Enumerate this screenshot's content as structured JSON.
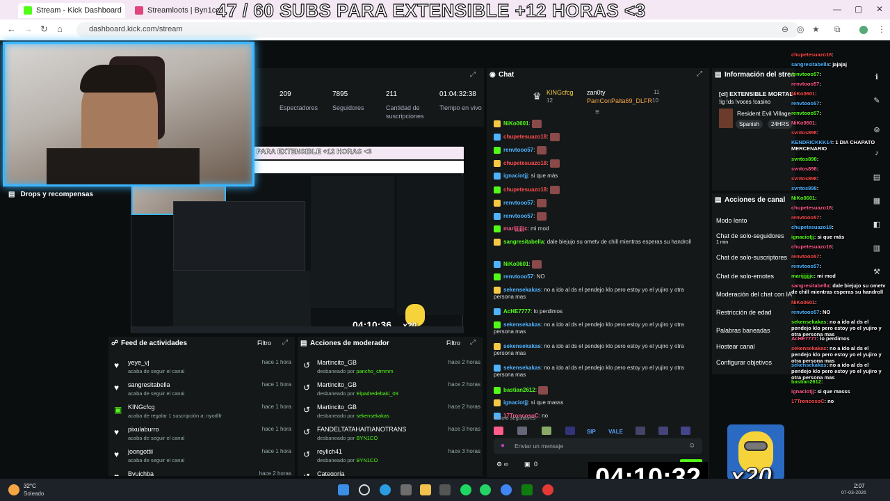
{
  "browser": {
    "tabs": [
      {
        "title": "Stream - Kick Dashboard",
        "active": true
      },
      {
        "title": "Streamloots | Byn1co | Apóyam",
        "active": false
      }
    ],
    "url": "dashboard.kick.com/stream"
  },
  "overlay": {
    "title": "47 / 60 SUBS PARA EXTENSIBLE +12 HORAS <3",
    "timer": "04:10:32",
    "multiplier": "x20",
    "mini_timer": "04:10:36",
    "mini_multiplier": "x20",
    "mini_title": "PARA EXTENSIBLE +12 HORAS <3"
  },
  "stats": [
    {
      "value": "209",
      "label": "Espectadores"
    },
    {
      "value": "7895",
      "label": "Seguidores"
    },
    {
      "value": "211",
      "label": "Cantidad de suscripciones"
    },
    {
      "value": "01:04:32:38",
      "label": "Tiempo en vivo"
    }
  ],
  "left_nav": {
    "drops_label": "Drops y recompensas"
  },
  "activity_feed": {
    "title": "Feed de actividades",
    "filter": "Filtro",
    "items": [
      {
        "name": "yeye_vj",
        "action": "acaba de seguir el canal",
        "time": "hace 1 hora",
        "icon": "heart-icon"
      },
      {
        "name": "sangresitabella",
        "action": "acaba de seguir el canal",
        "time": "hace 1 hora",
        "icon": "heart-icon"
      },
      {
        "name": "KINGcfcg",
        "action": "acaba de regalar 1 suscripción a: nyodlfr",
        "time": "hace 1 hora",
        "icon": "gift-icon"
      },
      {
        "name": "pixulaburro",
        "action": "acaba de seguir el canal",
        "time": "hace 1 hora",
        "icon": "heart-icon"
      },
      {
        "name": "joongottii",
        "action": "acaba de seguir el canal",
        "time": "hace 1 hora",
        "icon": "heart-icon"
      },
      {
        "name": "Byuichba",
        "action": "",
        "time": "hace 2 horas",
        "icon": "heart-icon"
      }
    ]
  },
  "mod_actions": {
    "title": "Acciones de moderador",
    "filter": "Filtro",
    "items": [
      {
        "name": "Martincito_GB",
        "action": "desbaneado por",
        "by": "pancho_ctmmm",
        "time": "hace 2 horas"
      },
      {
        "name": "Martincito_GB",
        "action": "desbaneado por",
        "by": "Elpadredebaki_09",
        "time": "hace 2 horas"
      },
      {
        "name": "Martincito_GB",
        "action": "desbaneado por",
        "by": "sekensekakas",
        "time": "hace 2 horas"
      },
      {
        "name": "FANDELTATAHAITIANOTRANS",
        "action": "desbaneado por",
        "by": "BYN1CO",
        "time": "hace 3 horas"
      },
      {
        "name": "reylich41",
        "action": "desbaneado por",
        "by": "BYN1CO",
        "time": "hace 3 horas"
      },
      {
        "name": "Categoría",
        "action": "",
        "by": "",
        "time": ""
      }
    ]
  },
  "chat": {
    "title": "Chat",
    "top_gifters": [
      {
        "name": "KINGcfcg",
        "count": "12"
      },
      {
        "name": "zan0ty",
        "count": "11"
      },
      {
        "name": "PamConPalta69_DLFR",
        "count": "10"
      }
    ],
    "messages": [
      {
        "user": "NiKo0601",
        "text": "",
        "color": "green"
      },
      {
        "user": "chupetesuazo18",
        "text": "",
        "color": "red"
      },
      {
        "user": "renvtooo57",
        "text": "",
        "color": "cyan"
      },
      {
        "user": "chupetesuazo18",
        "text": "",
        "color": "red"
      },
      {
        "user": "ignaciotjj",
        "text": "si que más",
        "color": "cyan"
      },
      {
        "user": "chupetesuazo18",
        "text": "",
        "color": "red"
      },
      {
        "user": "renvtooo57",
        "text": "",
        "color": "cyan"
      },
      {
        "user": "renvtooo57",
        "text": "",
        "color": "cyan"
      },
      {
        "user": "marijjjjjjc",
        "text": "mi mod",
        "color": "pink"
      },
      {
        "user": "sangresitabella",
        "text": "dale biejujo su ometv de chill mientras esperas su handroll",
        "color": "green"
      },
      {
        "user": "NiKo0601",
        "text": "",
        "color": "green"
      },
      {
        "user": "renvtooo57",
        "text": "NO",
        "color": "cyan"
      },
      {
        "user": "sekensekakas",
        "text": "no a ido al ds el pendejo klo pero estoy yo el yujiro y otra persona mas",
        "color": "cyan"
      },
      {
        "user": "AcHE7777",
        "text": "lo perdimos",
        "color": "green"
      },
      {
        "user": "sekensekakas",
        "text": "no a ido al ds el pendejo klo pero estoy yo el yujiro y otra persona mas",
        "color": "cyan"
      },
      {
        "user": "sekensekakas",
        "text": "no a ido al ds el pendejo klo pero estoy yo el yujiro y otra persona mas",
        "color": "cyan"
      },
      {
        "user": "sekensekakas",
        "text": "no a ido al ds el pendejo klo pero estoy yo el yujiro y otra persona mas",
        "color": "cyan"
      },
      {
        "user": "bastian2612",
        "text": "",
        "color": "green"
      },
      {
        "user": "ignaciotjj",
        "text": "si que masss",
        "color": "cyan"
      },
      {
        "user": "17TroncosoC",
        "text": "no",
        "color": "pink"
      }
    ],
    "followers_only": "Solo seguidores",
    "emote_labels": [
      "SIP",
      "VALE"
    ],
    "input_placeholder": "Enviar un mensaje",
    "points": "0",
    "send_button": "Chat"
  },
  "stream_info": {
    "title": "Información del stream",
    "stream_title": "[cl] EXTENSIBLE MORTAL +12 HORAS CTM",
    "commands": "!ig !ds !voces !casino",
    "category": "Resident Evil Village",
    "tags": [
      "Spanish",
      "24HRS"
    ]
  },
  "channel_actions": {
    "title": "Acciones de canal",
    "items": [
      {
        "label": "Modo lento",
        "sub": ""
      },
      {
        "label": "Chat de solo-seguidores",
        "sub": "1 min"
      },
      {
        "label": "Chat de solo-suscriptores",
        "sub": ""
      },
      {
        "label": "Chat de solo-emotes",
        "sub": ""
      },
      {
        "label": "Moderación del chat con IA",
        "sub": ""
      },
      {
        "label": "Restricción de edad",
        "sub": ""
      },
      {
        "label": "Palabras baneadas",
        "sub": ""
      },
      {
        "label": "Hostear canal",
        "sub": ""
      },
      {
        "label": "Configurar objetivos",
        "sub": ""
      }
    ]
  },
  "overlay_chat": [
    {
      "user": "chupetesuazo18",
      "text": ""
    },
    {
      "user": "sangresitabella",
      "text": "jajajaj"
    },
    {
      "user": "renvtooo57",
      "text": ""
    },
    {
      "user": "renvtooo57",
      "text": ""
    },
    {
      "user": "NiKo0601",
      "text": ""
    },
    {
      "user": "renvtooo57",
      "text": ""
    },
    {
      "user": "renvtooo57",
      "text": ""
    },
    {
      "user": "NiKo0601",
      "text": ""
    },
    {
      "user": "svntos898",
      "text": ""
    },
    {
      "user": "KENDRICKKK14",
      "text": "1 DIA CHAPATO MERCENARIO"
    },
    {
      "user": "svntos898",
      "text": ""
    },
    {
      "user": "svntos898",
      "text": ""
    },
    {
      "user": "svntos898",
      "text": ""
    },
    {
      "user": "svntos898",
      "text": ""
    },
    {
      "user": "NiKo0601",
      "text": ""
    },
    {
      "user": "chupetesuazo18",
      "text": ""
    },
    {
      "user": "renvtooo57",
      "text": ""
    },
    {
      "user": "chupetesuazo18",
      "text": ""
    },
    {
      "user": "ignaciotjj",
      "text": "si que más"
    },
    {
      "user": "chupetesuazo18",
      "text": ""
    },
    {
      "user": "renvtooo57",
      "text": ""
    },
    {
      "user": "renvtooo57",
      "text": ""
    },
    {
      "user": "marijjjjjjc",
      "text": "mi mod"
    },
    {
      "user": "sangresitabella",
      "text": "dale biejujo su ometv de chill mientras esperas su handroll"
    },
    {
      "user": "NiKo0601",
      "text": ""
    },
    {
      "user": "renvtooo57",
      "text": "NO"
    },
    {
      "user": "sekensekakas",
      "text": "no a ido al ds el pendejo klo pero estoy yo el yujiro y otra persona mas"
    },
    {
      "user": "AcHE7777",
      "text": "lo perdimos"
    },
    {
      "user": "sekensekakas",
      "text": "no a ido al ds el pendejo klo pero estoy yo el yujiro y otra persona mas"
    },
    {
      "user": "sekensekakas",
      "text": "no a ido al ds el pendejo klo pero estoy yo el yujiro y otra persona mas"
    },
    {
      "user": "bastian2612",
      "text": ""
    },
    {
      "user": "ignaciotjj",
      "text": "si que masss"
    },
    {
      "user": "17TroncosoC",
      "text": "no"
    }
  ],
  "taskbar": {
    "weather_temp": "32°C",
    "weather_desc": "Soleado",
    "time": "2:07",
    "date": "07-03-2026"
  },
  "colors": {
    "accent": "#53fc18",
    "panel": "#141819",
    "bg": "#0b0e0f"
  }
}
